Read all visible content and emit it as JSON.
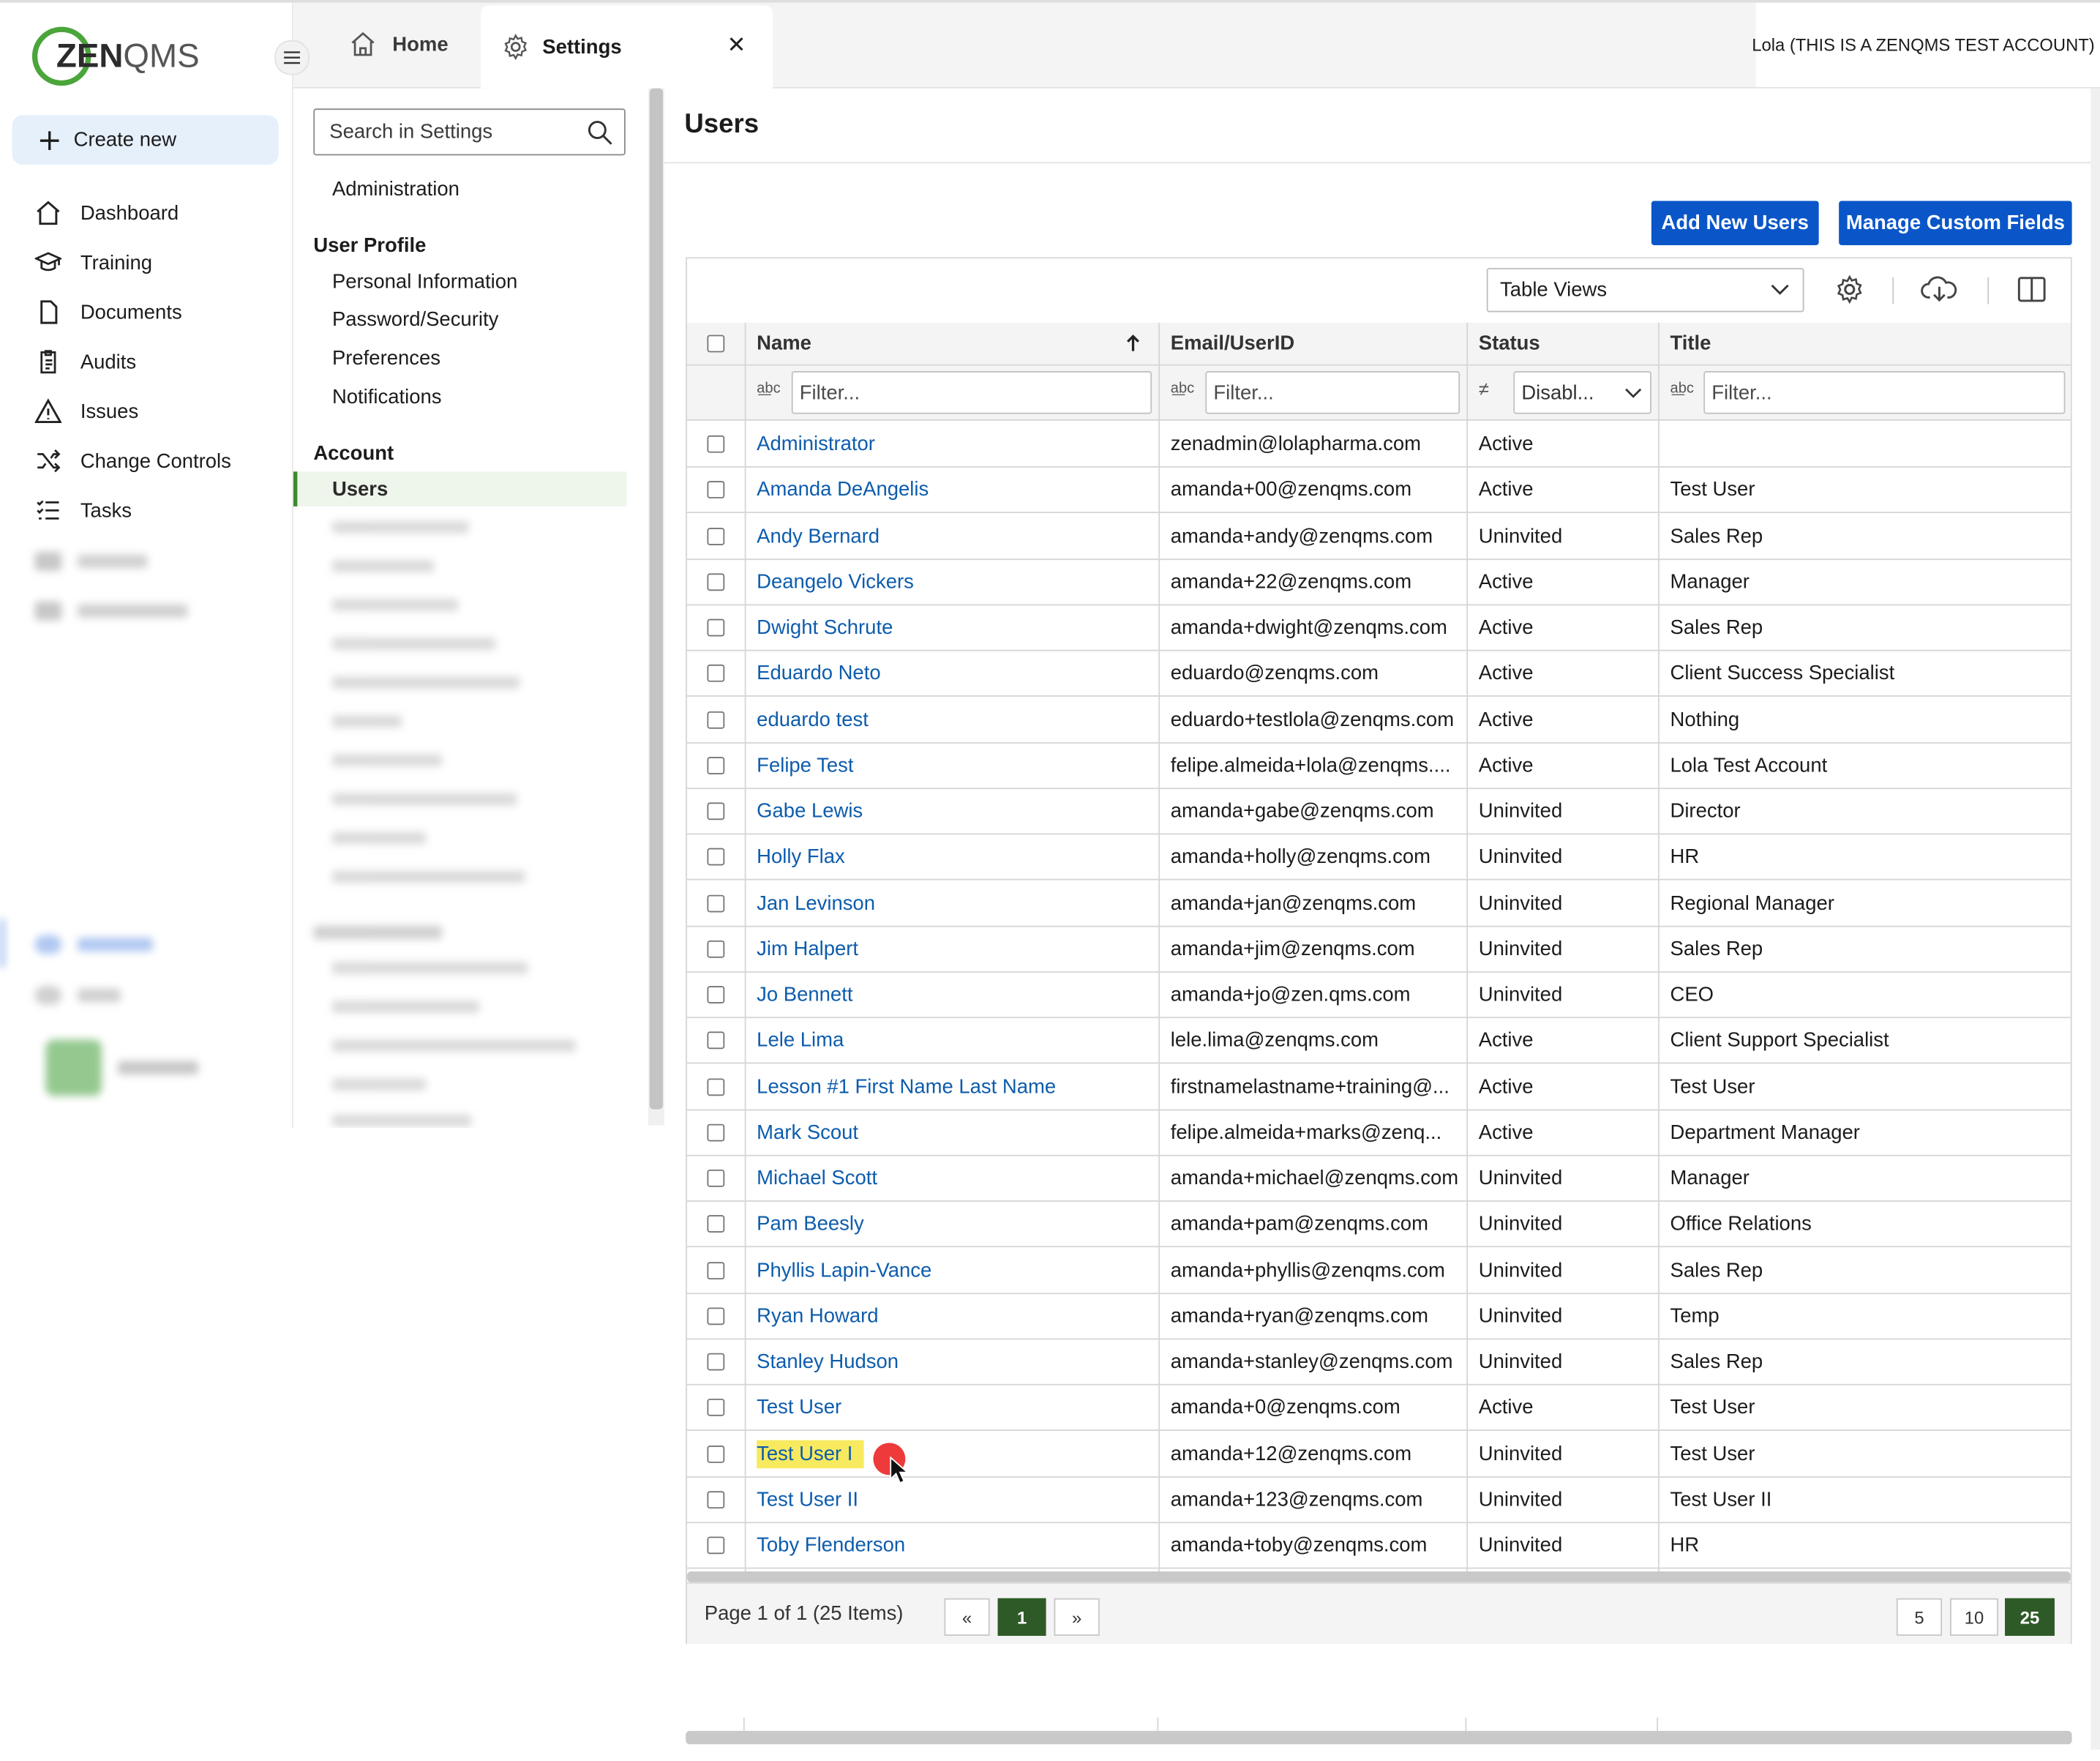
{
  "app": {
    "logo_text": "ZENQMS",
    "account_label": "Lola (THIS IS A ZENQMS TEST ACCOUNT)"
  },
  "sidebar": {
    "create_label": "Create new",
    "items": [
      {
        "label": "Dashboard",
        "icon": "home-icon"
      },
      {
        "label": "Training",
        "icon": "graduation-cap-icon"
      },
      {
        "label": "Documents",
        "icon": "document-icon"
      },
      {
        "label": "Audits",
        "icon": "clipboard-icon"
      },
      {
        "label": "Issues",
        "icon": "warning-icon"
      },
      {
        "label": "Change Controls",
        "icon": "shuffle-icon"
      },
      {
        "label": "Tasks",
        "icon": "checklist-icon"
      }
    ]
  },
  "tabs": [
    {
      "label": "Home",
      "icon": "home-icon"
    },
    {
      "label": "Settings",
      "icon": "gear-icon",
      "active": true
    }
  ],
  "settings_nav": {
    "search_placeholder": "Search in Settings",
    "administration": "Administration",
    "user_profile_heading": "User Profile",
    "user_profile_items": [
      "Personal Information",
      "Password/Security",
      "Preferences",
      "Notifications"
    ],
    "account_heading": "Account",
    "account_active_item": "Users"
  },
  "main": {
    "title": "Users",
    "add_button": "Add New Users",
    "manage_button": "Manage Custom Fields",
    "table_views_label": "Table Views",
    "columns": {
      "name": "Name",
      "email": "Email/UserID",
      "status": "Status",
      "title": "Title"
    },
    "filters": {
      "name_placeholder": "Filter...",
      "email_placeholder": "Filter...",
      "status_value": "Disabl...",
      "title_placeholder": "Filter..."
    },
    "rows": [
      {
        "name": "Administrator",
        "email": "zenadmin@lolapharma.com",
        "status": "Active",
        "title": ""
      },
      {
        "name": "Amanda DeAngelis",
        "email": "amanda+00@zenqms.com",
        "status": "Active",
        "title": "Test User"
      },
      {
        "name": "Andy Bernard",
        "email": "amanda+andy@zenqms.com",
        "status": "Uninvited",
        "title": "Sales Rep"
      },
      {
        "name": "Deangelo Vickers",
        "email": "amanda+22@zenqms.com",
        "status": "Active",
        "title": "Manager"
      },
      {
        "name": "Dwight Schrute",
        "email": "amanda+dwight@zenqms.com",
        "status": "Active",
        "title": "Sales Rep"
      },
      {
        "name": "Eduardo Neto",
        "email": "eduardo@zenqms.com",
        "status": "Active",
        "title": "Client Success Specialist"
      },
      {
        "name": "eduardo test",
        "email": "eduardo+testlola@zenqms.com",
        "status": "Active",
        "title": "Nothing"
      },
      {
        "name": "Felipe Test",
        "email": "felipe.almeida+lola@zenqms....",
        "status": "Active",
        "title": "Lola Test Account"
      },
      {
        "name": "Gabe Lewis",
        "email": "amanda+gabe@zenqms.com",
        "status": "Uninvited",
        "title": "Director"
      },
      {
        "name": "Holly Flax",
        "email": "amanda+holly@zenqms.com",
        "status": "Uninvited",
        "title": "HR"
      },
      {
        "name": "Jan Levinson",
        "email": "amanda+jan@zenqms.com",
        "status": "Uninvited",
        "title": "Regional Manager"
      },
      {
        "name": "Jim Halpert",
        "email": "amanda+jim@zenqms.com",
        "status": "Uninvited",
        "title": "Sales Rep"
      },
      {
        "name": "Jo Bennett",
        "email": "amanda+jo@zen.qms.com",
        "status": "Uninvited",
        "title": "CEO"
      },
      {
        "name": "Lele Lima",
        "email": "lele.lima@zenqms.com",
        "status": "Active",
        "title": "Client Support Specialist"
      },
      {
        "name": "Lesson #1 First Name Last Name",
        "email": "firstnamelastname+training@...",
        "status": "Active",
        "title": "Test User"
      },
      {
        "name": "Mark Scout",
        "email": "felipe.almeida+marks@zenq...",
        "status": "Active",
        "title": "Department Manager"
      },
      {
        "name": "Michael Scott",
        "email": "amanda+michael@zenqms.com",
        "status": "Uninvited",
        "title": "Manager"
      },
      {
        "name": "Pam Beesly",
        "email": "amanda+pam@zenqms.com",
        "status": "Uninvited",
        "title": "Office Relations"
      },
      {
        "name": "Phyllis Lapin-Vance",
        "email": "amanda+phyllis@zenqms.com",
        "status": "Uninvited",
        "title": "Sales Rep"
      },
      {
        "name": "Ryan Howard",
        "email": "amanda+ryan@zenqms.com",
        "status": "Uninvited",
        "title": "Temp"
      },
      {
        "name": "Stanley Hudson",
        "email": "amanda+stanley@zenqms.com",
        "status": "Uninvited",
        "title": "Sales Rep"
      },
      {
        "name": "Test User",
        "email": "amanda+0@zenqms.com",
        "status": "Active",
        "title": "Test User"
      },
      {
        "name": "Test User I",
        "email": "amanda+12@zenqms.com",
        "status": "Uninvited",
        "title": "Test User",
        "highlighted": true
      },
      {
        "name": "Test User II",
        "email": "amanda+123@zenqms.com",
        "status": "Uninvited",
        "title": "Test User II"
      },
      {
        "name": "Toby Flenderson",
        "email": "amanda+toby@zenqms.com",
        "status": "Uninvited",
        "title": "HR"
      }
    ],
    "pager": {
      "summary": "Page 1 of 1 (25 Items)",
      "prev": "«",
      "current_page": "1",
      "next": "»",
      "page_sizes": [
        "5",
        "10",
        "25"
      ],
      "active_page_size": "25"
    }
  },
  "colors": {
    "brand_green": "#3d8b2f",
    "link_blue": "#0d5cad",
    "button_blue": "#0a56c9",
    "pager_active": "#2e5a27",
    "highlight_yellow": "#f7ea5f"
  }
}
